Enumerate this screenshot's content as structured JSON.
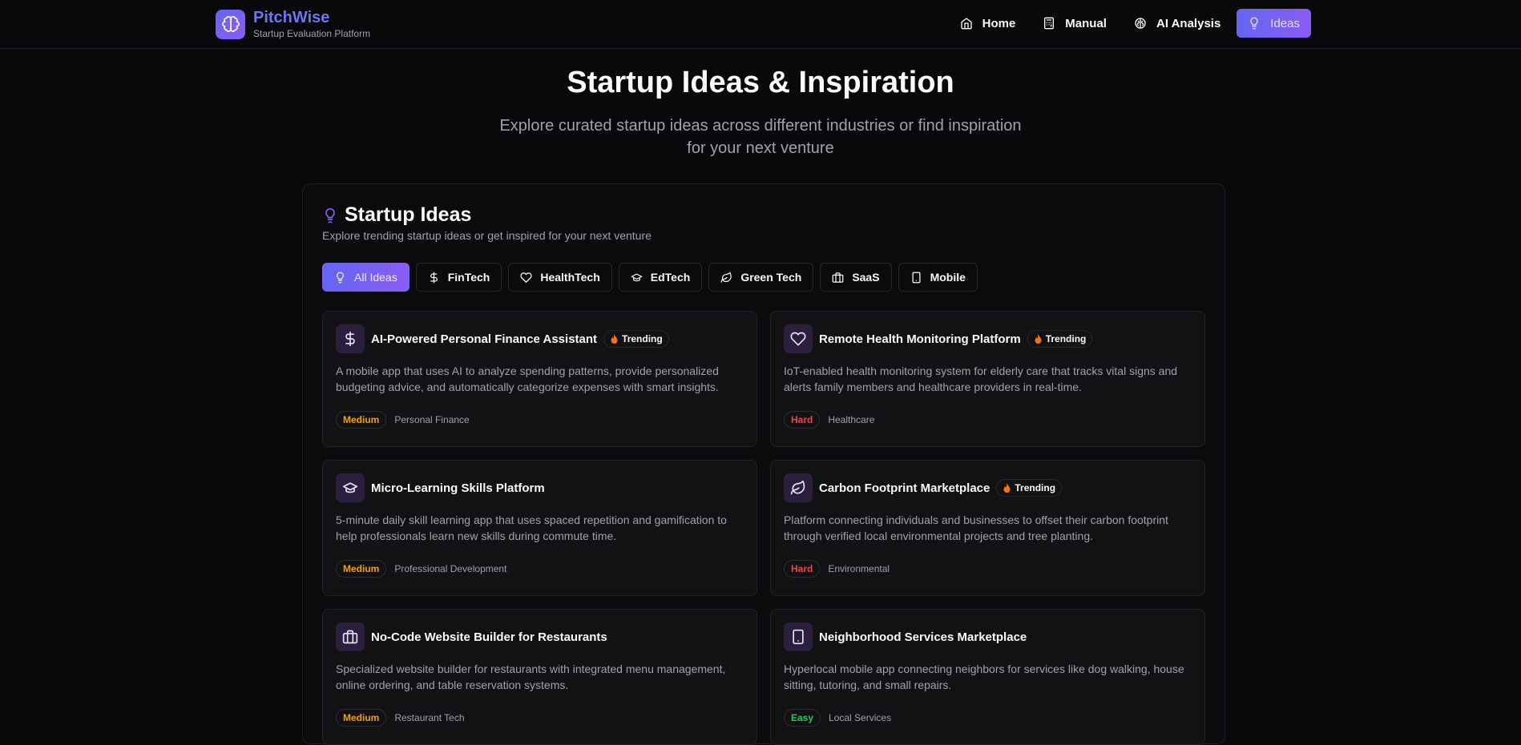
{
  "header": {
    "brand_name": "PitchWise",
    "brand_sub": "Startup Evaluation Platform",
    "nav": [
      {
        "label": "Home",
        "icon": "home-icon"
      },
      {
        "label": "Manual",
        "icon": "calculator-icon"
      },
      {
        "label": "AI Analysis",
        "icon": "brain-icon"
      },
      {
        "label": "Ideas",
        "icon": "lightbulb-icon",
        "active": true
      }
    ]
  },
  "hero": {
    "title": "Startup Ideas & Inspiration",
    "subtitle": "Explore curated startup ideas across different industries or find inspiration for your next venture"
  },
  "panel": {
    "title": "Startup Ideas",
    "subtitle": "Explore trending startup ideas or get inspired for your next venture",
    "filters": [
      {
        "label": "All Ideas",
        "icon": "lightbulb-icon",
        "active": true
      },
      {
        "label": "FinTech",
        "icon": "dollar-icon"
      },
      {
        "label": "HealthTech",
        "icon": "heart-icon"
      },
      {
        "label": "EdTech",
        "icon": "graduation-cap-icon"
      },
      {
        "label": "Green Tech",
        "icon": "leaf-icon"
      },
      {
        "label": "SaaS",
        "icon": "briefcase-icon"
      },
      {
        "label": "Mobile",
        "icon": "smartphone-icon"
      }
    ],
    "trending_label": "Trending",
    "cards": [
      {
        "title": "AI-Powered Personal Finance Assistant",
        "trending": true,
        "icon": "dollar-icon",
        "description": "A mobile app that uses AI to analyze spending patterns, provide personalized budgeting advice, and automatically categorize expenses with smart insights.",
        "difficulty": "Medium",
        "category": "Personal Finance"
      },
      {
        "title": "Remote Health Monitoring Platform",
        "trending": true,
        "icon": "heart-icon",
        "description": "IoT-enabled health monitoring system for elderly care that tracks vital signs and alerts family members and healthcare providers in real-time.",
        "difficulty": "Hard",
        "category": "Healthcare"
      },
      {
        "title": "Micro-Learning Skills Platform",
        "trending": false,
        "icon": "graduation-cap-icon",
        "description": "5-minute daily skill learning app that uses spaced repetition and gamification to help professionals learn new skills during commute time.",
        "difficulty": "Medium",
        "category": "Professional Development"
      },
      {
        "title": "Carbon Footprint Marketplace",
        "trending": true,
        "icon": "leaf-icon",
        "description": "Platform connecting individuals and businesses to offset their carbon footprint through verified local environmental projects and tree planting.",
        "difficulty": "Hard",
        "category": "Environmental"
      },
      {
        "title": "No-Code Website Builder for Restaurants",
        "trending": false,
        "icon": "briefcase-icon",
        "description": "Specialized website builder for restaurants with integrated menu management, online ordering, and table reservation systems.",
        "difficulty": "Medium",
        "category": "Restaurant Tech"
      },
      {
        "title": "Neighborhood Services Marketplace",
        "trending": false,
        "icon": "smartphone-icon",
        "description": "Hyperlocal mobile app connecting neighbors for services like dog walking, house sitting, tutoring, and small repairs.",
        "difficulty": "Easy",
        "category": "Local Services"
      }
    ]
  },
  "colors": {
    "accent_start": "#6366f1",
    "accent_end": "#8b5cf6",
    "medium": "#f59e0b",
    "hard": "#ef4444",
    "easy": "#22c55e",
    "icon_purple": "#a78bfa"
  }
}
